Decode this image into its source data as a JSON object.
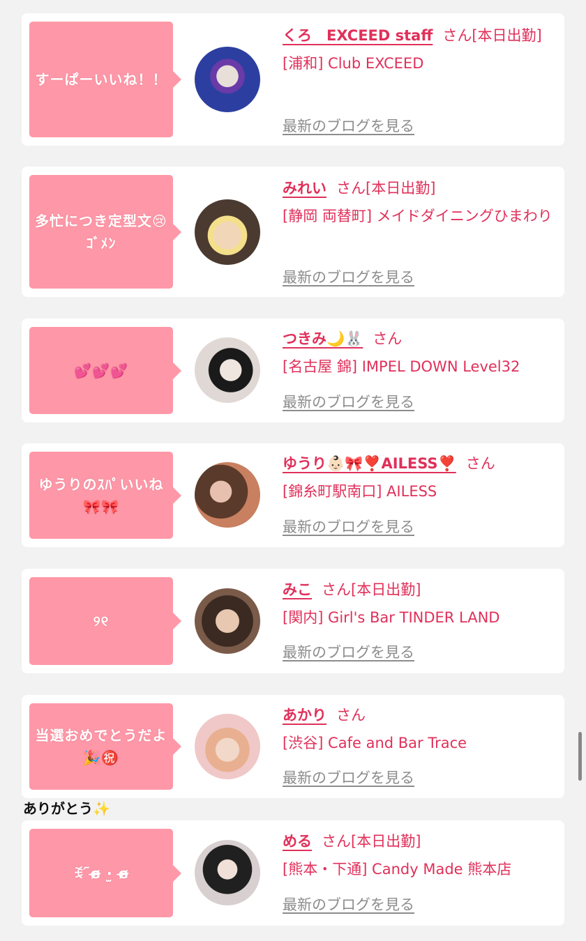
{
  "entries": [
    {
      "comment": "すーぱーいいね！！",
      "name": "くろ　EXCEED staff",
      "suffix": "さん[本日出勤]",
      "shop": "[浦和] Club EXCEED",
      "blog_link": "最新のブログを見る",
      "avatar_colors": [
        "#2c3fa0",
        "#e8e0d8"
      ]
    },
    {
      "comment": "多忙につき定型文😢ｺﾞﾒﾝ",
      "name": "みれい",
      "suffix": "さん[本日出勤]",
      "shop": "[静岡 両替町] メイドダイニングひまわり",
      "blog_link": "最新のブログを見る",
      "avatar_colors": [
        "#4a3a30",
        "#f2d6b8"
      ]
    },
    {
      "comment": "💕💕💕",
      "name": "つきみ🌙🐰",
      "suffix": "さん",
      "shop": "[名古屋 錦] IMPEL DOWN Level32",
      "blog_link": "最新のブログを見る",
      "avatar_colors": [
        "#1a1a1a",
        "#f0e6e0"
      ]
    },
    {
      "comment": "ゆうりのｽﾊﾟいいね🎀🎀",
      "name": "ゆうり👶🏻🎀❣️AILESS❣️",
      "suffix": "さん",
      "shop": "[錦糸町駅南口] AILESS",
      "blog_link": "最新のブログを見る",
      "avatar_colors": [
        "#5a3a2a",
        "#c88060"
      ]
    },
    {
      "comment": "୨୧",
      "name": "みこ",
      "suffix": "さん[本日出勤]",
      "shop": "[関内] Girl's Bar TINDER LAND",
      "blog_link": "最新のブログを見る",
      "avatar_colors": [
        "#3a2a22",
        "#e8c8b0"
      ]
    },
    {
      "comment": "当選おめでとうだよ🎉㊗️",
      "name": "あかり",
      "suffix": "さん",
      "shop": "[渋谷] Cafe and Bar Trace",
      "blog_link": "最新のブログを見る",
      "avatar_colors": [
        "#f0c8c8",
        "#e8b090"
      ]
    },
    {
      "comment": "ꉂ ᷇ɞ̴̶̷ ·̫ ɞ̴̶̷",
      "name": "める",
      "suffix": "さん[本日出勤]",
      "shop": "[熊本・下通] Candy Made 熊本店",
      "blog_link": "最新のブログを見る",
      "avatar_colors": [
        "#202020",
        "#d8d0d0"
      ]
    }
  ],
  "floating_text": "ありがとう✨"
}
